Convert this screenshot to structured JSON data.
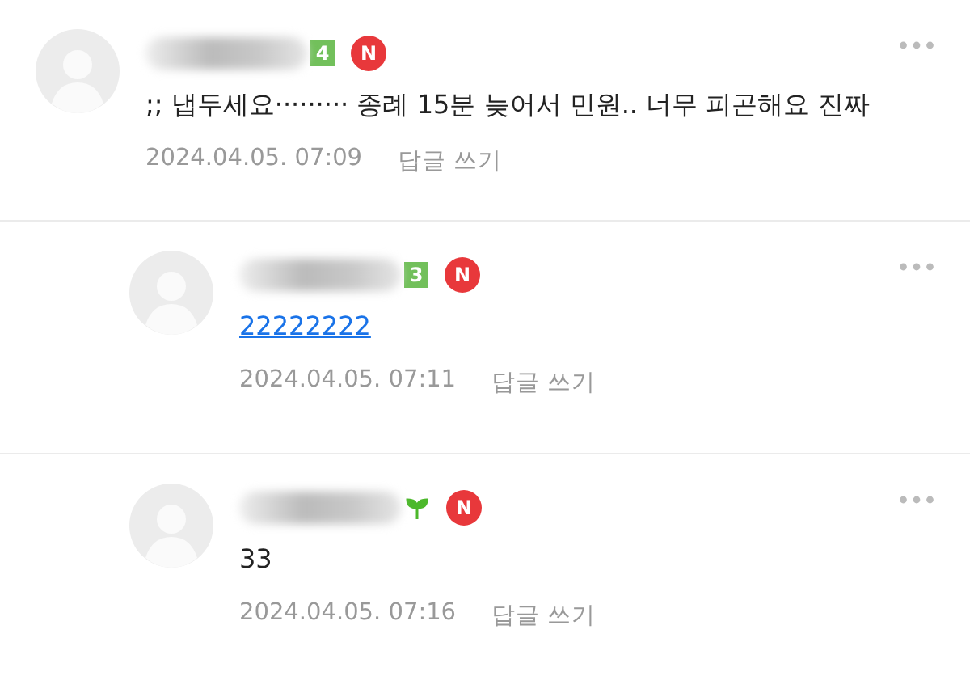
{
  "comments": [
    {
      "badge": {
        "kind": "level",
        "text": "4"
      },
      "new_mark": "N",
      "content": {
        "kind": "text",
        "text": ";; 냅두세요········· 종례 15분 늦어서 민원.. 너무 피곤해요 진짜"
      },
      "date": "2024.04.05. 07:09",
      "reply_label": "답글 쓰기",
      "children": [
        {
          "badge": {
            "kind": "level",
            "text": "3"
          },
          "new_mark": "N",
          "content": {
            "kind": "link",
            "text": "22222222"
          },
          "date": "2024.04.05. 07:11",
          "reply_label": "답글 쓰기"
        },
        {
          "badge": {
            "kind": "sprout"
          },
          "new_mark": "N",
          "content": {
            "kind": "text",
            "text": "33"
          },
          "date": "2024.04.05. 07:16",
          "reply_label": "답글 쓰기"
        }
      ]
    }
  ]
}
